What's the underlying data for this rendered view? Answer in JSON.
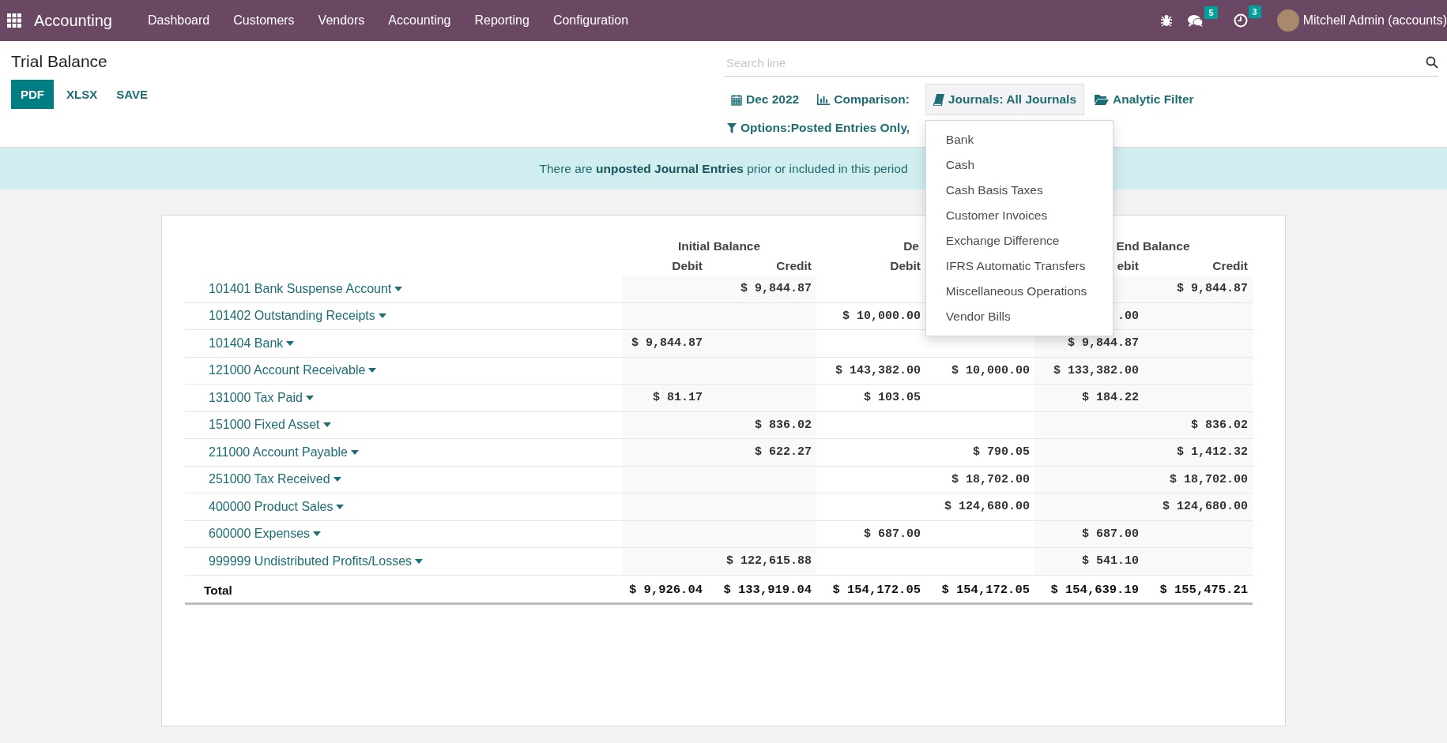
{
  "navbar": {
    "app_name": "Accounting",
    "menu": [
      "Dashboard",
      "Customers",
      "Vendors",
      "Accounting",
      "Reporting",
      "Configuration"
    ],
    "messages_count": "5",
    "activities_count": "3",
    "user": "Mitchell Admin (accounts)"
  },
  "control_panel": {
    "title": "Trial Balance",
    "buttons": [
      {
        "label": "PDF",
        "kind": "primary"
      },
      {
        "label": "XLSX",
        "kind": "link"
      },
      {
        "label": "SAVE",
        "kind": "link"
      }
    ],
    "search": {
      "placeholder": "Search line"
    },
    "filters": [
      {
        "kind": "date",
        "label": "Dec 2022",
        "open": false
      },
      {
        "kind": "comparison",
        "label": "Comparison:",
        "open": false
      },
      {
        "kind": "journals",
        "label": "Journals: All Journals",
        "open": true,
        "items": [
          "Bank",
          "Cash",
          "Cash Basis Taxes",
          "Customer Invoices",
          "Exchange Difference",
          "IFRS Automatic Transfers",
          "Miscellaneous Operations",
          "Vendor Bills"
        ]
      },
      {
        "kind": "analytic",
        "label": "Analytic Filter",
        "open": false
      },
      {
        "kind": "options",
        "label": "Options:Posted Entries Only,",
        "open": false
      }
    ]
  },
  "banner": {
    "text": "There are **unposted Journal Entries** prior or included in this period"
  },
  "table": {
    "groups": [
      "Initial Balance",
      "De",
      "End Balance"
    ],
    "columns": [
      "Debit",
      "Credit",
      "Debit",
      null,
      "ebit",
      "Credit"
    ],
    "rows": [
      {
        "account": "101401 Bank Suspense Account",
        "cells": [
          null,
          "$ 9,844.87",
          null,
          null,
          null,
          "$ 9,844.87"
        ]
      },
      {
        "account": "101402 Outstanding Receipts",
        "cells": [
          null,
          null,
          "$ 10,000.00",
          null,
          ".00",
          null
        ]
      },
      {
        "account": "101404 Bank",
        "cells": [
          "$ 9,844.87",
          null,
          null,
          null,
          "$ 9,844.87",
          null
        ]
      },
      {
        "account": "121000 Account Receivable",
        "cells": [
          null,
          null,
          "$ 143,382.00",
          "$ 10,000.00",
          "$ 133,382.00",
          null
        ]
      },
      {
        "account": "131000 Tax Paid",
        "cells": [
          "$ 81.17",
          null,
          "$ 103.05",
          null,
          "$ 184.22",
          null
        ]
      },
      {
        "account": "151000 Fixed Asset",
        "cells": [
          null,
          "$ 836.02",
          null,
          null,
          null,
          "$ 836.02"
        ]
      },
      {
        "account": "211000 Account Payable",
        "cells": [
          null,
          "$ 622.27",
          null,
          "$ 790.05",
          null,
          "$ 1,412.32"
        ]
      },
      {
        "account": "251000 Tax Received",
        "cells": [
          null,
          null,
          null,
          "$ 18,702.00",
          null,
          "$ 18,702.00"
        ]
      },
      {
        "account": "400000 Product Sales",
        "cells": [
          null,
          null,
          null,
          "$ 124,680.00",
          null,
          "$ 124,680.00"
        ]
      },
      {
        "account": "600000 Expenses",
        "cells": [
          null,
          null,
          "$ 687.00",
          null,
          "$ 687.00",
          null
        ]
      },
      {
        "account": "999999 Undistributed Profits/Losses",
        "cells": [
          null,
          "$ 122,615.88",
          null,
          null,
          "$ 541.10",
          null
        ]
      }
    ],
    "total": {
      "label": "Total",
      "cells": [
        "$ 9,926.04",
        "$ 133,919.04",
        "$ 154,172.05",
        "$ 154,172.05",
        "$ 154,639.19",
        "$ 155,475.21"
      ]
    }
  }
}
